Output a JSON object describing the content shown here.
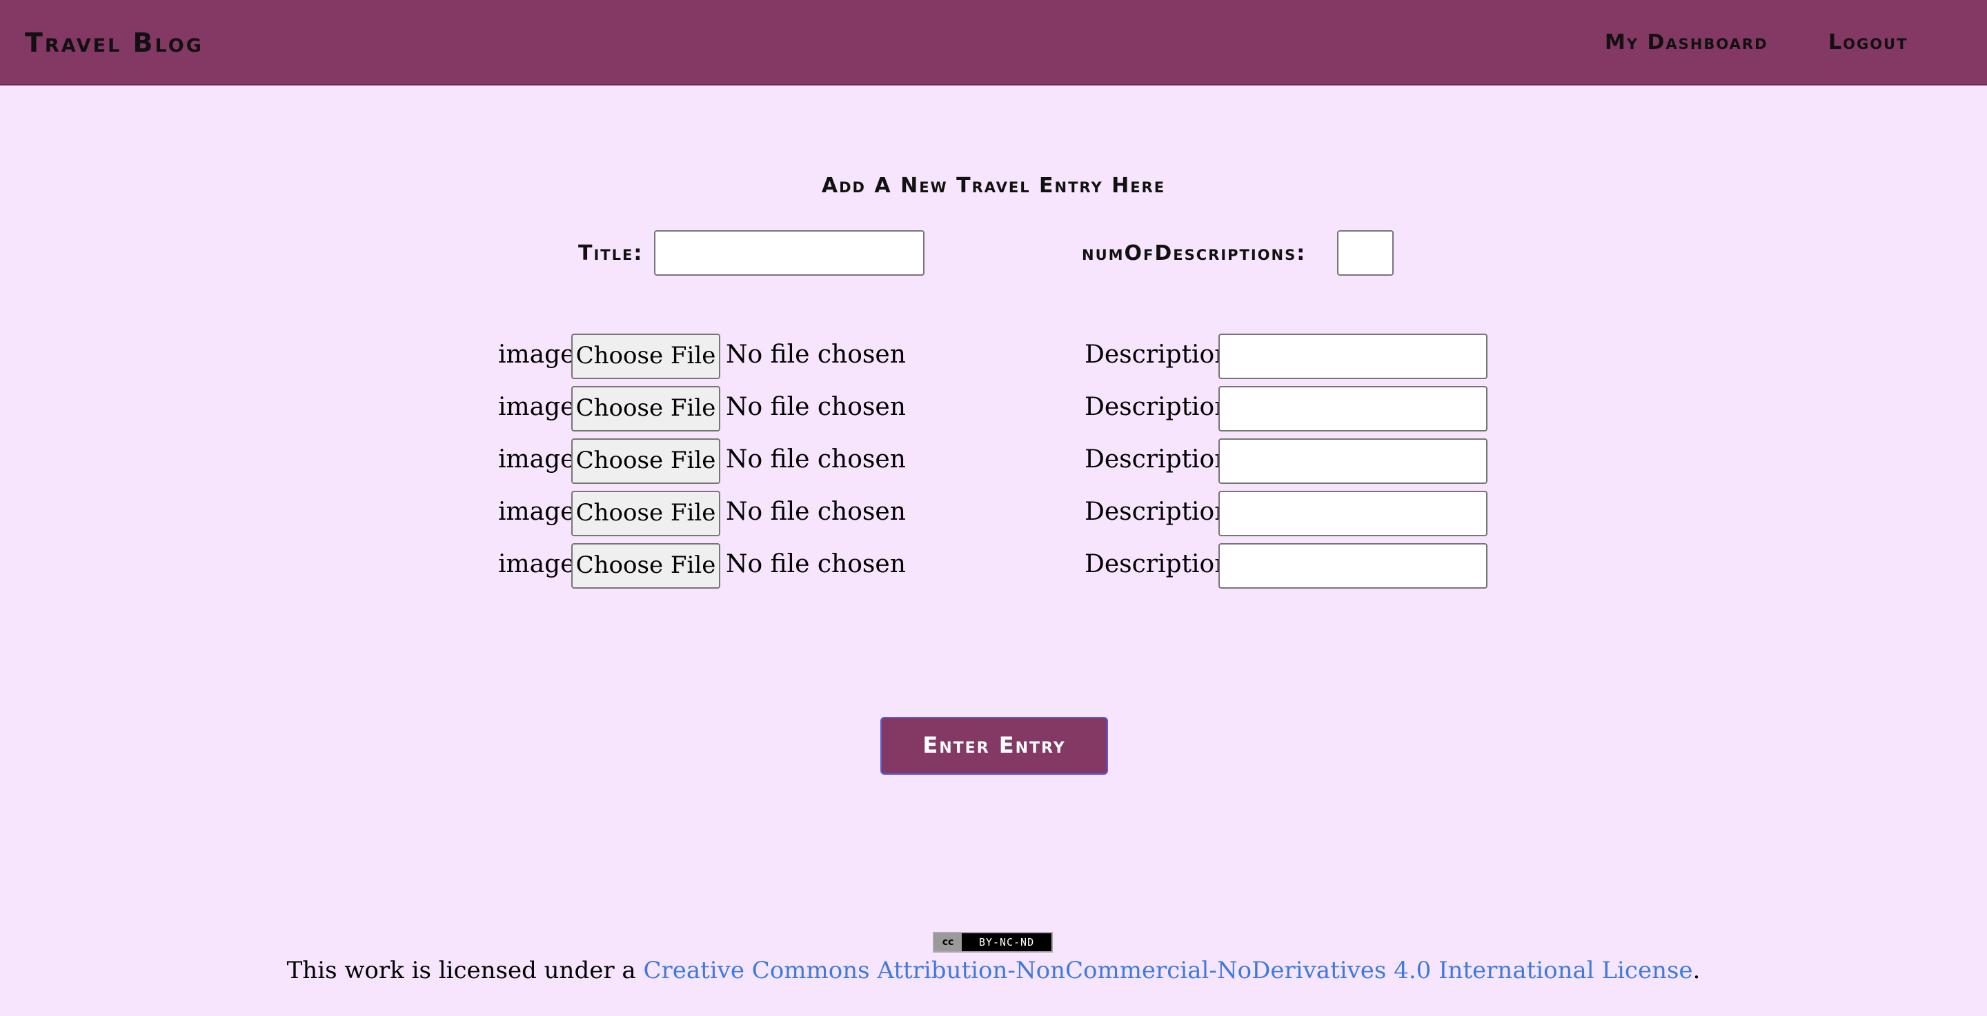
{
  "header": {
    "brand": "Travel Blog",
    "nav": {
      "dashboard": "My Dashboard",
      "logout": "Logout"
    }
  },
  "form": {
    "heading": "Add A New Travel Entry Here",
    "title_label": "Title:",
    "title_value": "",
    "num_descriptions_label": "numOfDescriptions:",
    "num_descriptions_value": "",
    "rows": [
      {
        "image_label": "image:",
        "button": "Choose File",
        "file_status": "No file chosen",
        "description_label": "Description:",
        "description_value": ""
      },
      {
        "image_label": "image:",
        "button": "Choose File",
        "file_status": "No file chosen",
        "description_label": "Description:",
        "description_value": ""
      },
      {
        "image_label": "image:",
        "button": "Choose File",
        "file_status": "No file chosen",
        "description_label": "Description:",
        "description_value": ""
      },
      {
        "image_label": "image:",
        "button": "Choose File",
        "file_status": "No file chosen",
        "description_label": "Description:",
        "description_value": ""
      },
      {
        "image_label": "image:",
        "button": "Choose File",
        "file_status": "No file chosen",
        "description_label": "Description:",
        "description_value": ""
      }
    ],
    "submit_label": "Enter Entry"
  },
  "footer": {
    "badge_cc": "cc",
    "badge_text": "BY-NC-ND",
    "license_prefix": "This work is licensed under a ",
    "license_link": "Creative Commons Attribution-NonCommercial-NoDerivatives 4.0 International License",
    "license_suffix": "."
  },
  "colors": {
    "header_bg": "#843864",
    "page_bg": "#f7e5fd",
    "link": "#3d7ae0"
  }
}
